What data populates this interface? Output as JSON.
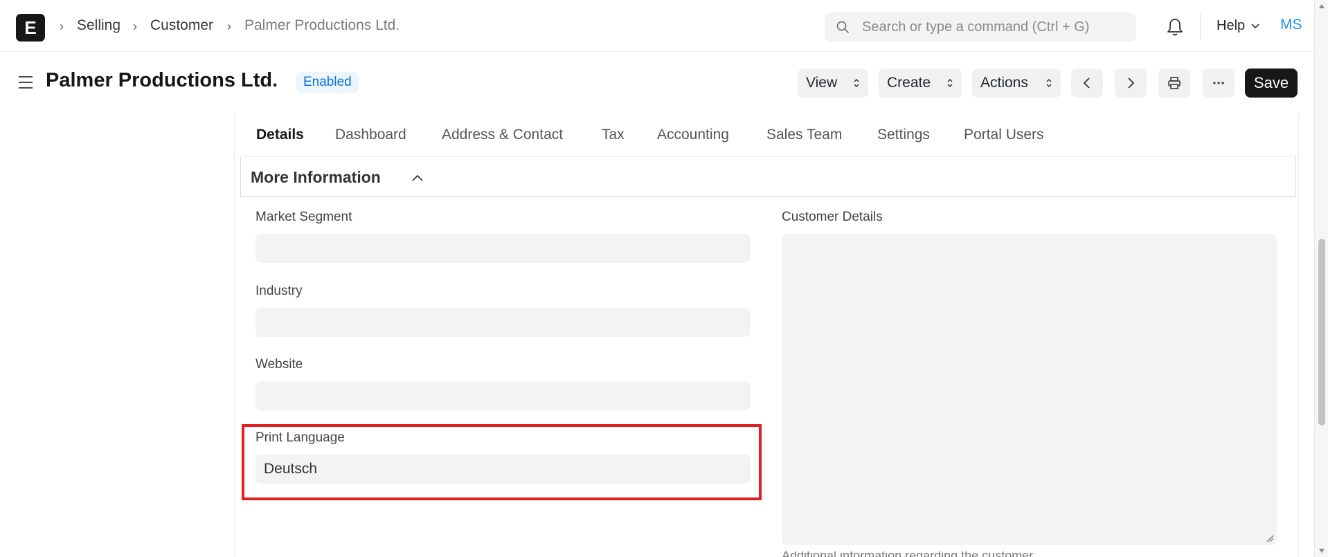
{
  "navbar": {
    "logo_letter": "E",
    "breadcrumbs": [
      "Selling",
      "Customer",
      "Palmer Productions Ltd."
    ],
    "search_placeholder": "Search or type a command (Ctrl + G)",
    "help_label": "Help",
    "avatar_initials": "MS"
  },
  "page": {
    "title": "Palmer Productions Ltd.",
    "status": "Enabled",
    "buttons": {
      "view": "View",
      "create": "Create",
      "actions": "Actions",
      "save": "Save"
    }
  },
  "tabs": [
    "Details",
    "Dashboard",
    "Address & Contact",
    "Tax",
    "Accounting",
    "Sales Team",
    "Settings",
    "Portal Users"
  ],
  "active_tab": "Details",
  "section": {
    "title": "More Information"
  },
  "fields": {
    "market_segment": {
      "label": "Market Segment",
      "value": ""
    },
    "industry": {
      "label": "Industry",
      "value": ""
    },
    "website": {
      "label": "Website",
      "value": ""
    },
    "print_language": {
      "label": "Print Language",
      "value": "Deutsch"
    },
    "customer_details": {
      "label": "Customer Details",
      "value": "",
      "help": "Additional information regarding the customer."
    }
  },
  "colors": {
    "accent": "#2490ef",
    "highlight": "#e02020",
    "badge_bg": "#eaf5fe",
    "badge_text": "#0b72cf"
  },
  "icons": [
    "app-logo",
    "chevron-right-icon",
    "search-icon",
    "bell-icon",
    "chevron-down-icon",
    "hamburger-icon",
    "updown-icon",
    "chevron-left-icon",
    "printer-icon",
    "more-icon",
    "chevron-up-icon",
    "resize-handle-icon"
  ]
}
